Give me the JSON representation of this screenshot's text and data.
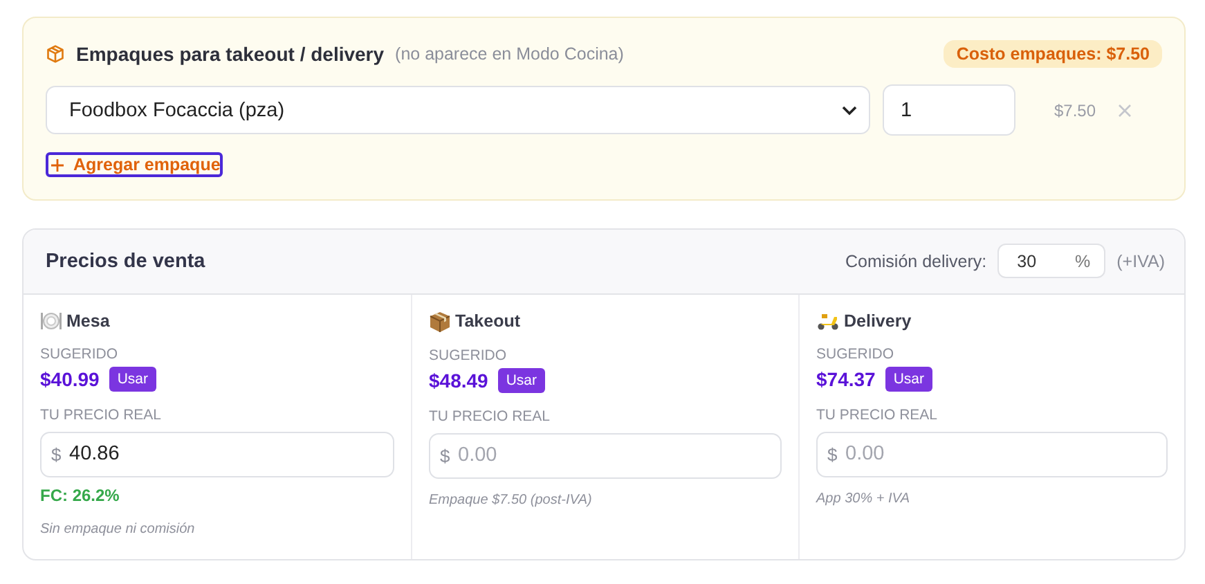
{
  "packaging": {
    "title": "Empaques para takeout / delivery",
    "note": "(no aparece en Modo Cocina)",
    "cost_badge": "Costo empaques: $7.50",
    "items": [
      {
        "product": "Foodbox Focaccia (pza)",
        "quantity": "1",
        "price": "$7.50"
      }
    ],
    "add_button": "Agregar empaque"
  },
  "pricing": {
    "title": "Precios de venta",
    "commission_label": "Comisión delivery:",
    "commission_value": "30",
    "commission_unit": "%",
    "commission_note": "(+IVA)",
    "columns": [
      {
        "kind": "plate",
        "name": "Mesa",
        "suggested_label": "SUGERIDO",
        "suggested": "$40.99",
        "use_button": "Usar",
        "real_label": "TU PRECIO REAL",
        "currency": "$",
        "value": "40.86",
        "food_cost": "FC: 26.2%",
        "note": "Sin empaque ni comisión"
      },
      {
        "kind": "box",
        "name": "Takeout",
        "suggested_label": "SUGERIDO",
        "suggested": "$48.49",
        "use_button": "Usar",
        "real_label": "TU PRECIO REAL",
        "currency": "$",
        "placeholder": "0.00",
        "note": "Empaque $7.50 (post-IVA)"
      },
      {
        "kind": "scooter",
        "name": "Delivery",
        "suggested_label": "SUGERIDO",
        "suggested": "$74.37",
        "use_button": "Usar",
        "real_label": "TU PRECIO REAL",
        "currency": "$",
        "placeholder": "0.00",
        "note": "App 30% + IVA"
      }
    ]
  }
}
